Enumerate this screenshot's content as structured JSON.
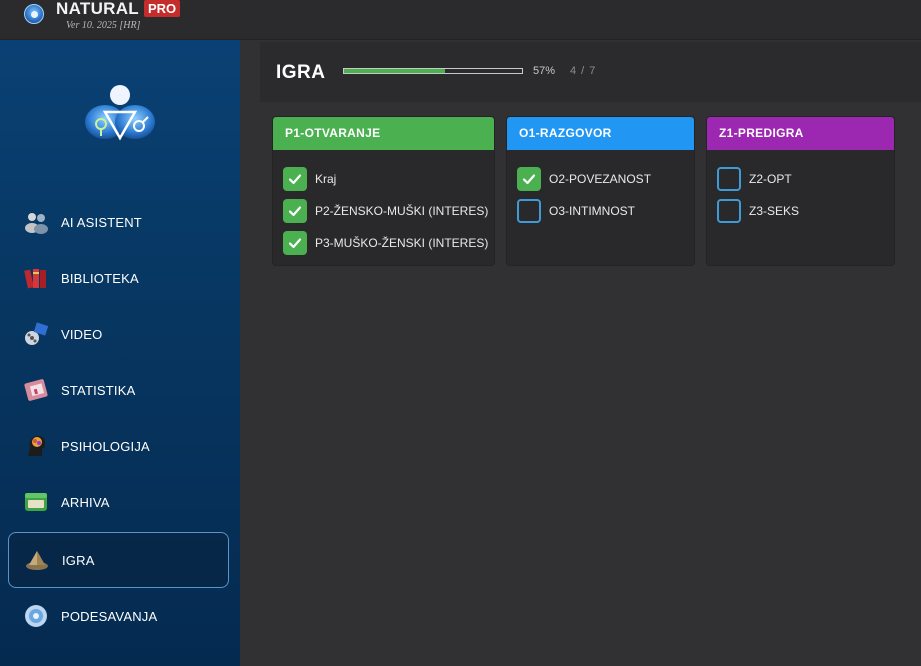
{
  "app": {
    "name": "NATURAL",
    "badge": "PRO",
    "version": "Ver 10. 2025 [HR]"
  },
  "sidebar": {
    "items": [
      {
        "label": "AI ASISTENT",
        "icon": "people-icon",
        "active": false
      },
      {
        "label": "BIBLIOTEKA",
        "icon": "books-icon",
        "active": false
      },
      {
        "label": "VIDEO",
        "icon": "film-reel-icon",
        "active": false
      },
      {
        "label": "STATISTIKA",
        "icon": "chart-icon",
        "active": false
      },
      {
        "label": "PSIHOLOGIJA",
        "icon": "head-brain-icon",
        "active": false
      },
      {
        "label": "ARHIVA",
        "icon": "archive-icon",
        "active": false
      },
      {
        "label": "IGRA",
        "icon": "pyramid-icon",
        "active": true
      },
      {
        "label": "PODESAVANJA",
        "icon": "settings-disc-icon",
        "active": false
      }
    ]
  },
  "header": {
    "title": "IGRA",
    "progress_percent": 57,
    "progress_label": "57%",
    "count_label": "4 / 7"
  },
  "columns": [
    {
      "title": "P1-OTVARANJE",
      "color": "#4bb04f",
      "items": [
        {
          "label": "Kraj",
          "checked": true
        },
        {
          "label": "P2-ŽENSKO-MUŠKI (INTERES)",
          "checked": true
        },
        {
          "label": "P3-MUŠKO-ŽENSKI (INTERES)",
          "checked": true
        }
      ]
    },
    {
      "title": "O1-RAZGOVOR",
      "color": "#2196f3",
      "items": [
        {
          "label": "O2-POVEZANOST",
          "checked": true
        },
        {
          "label": "O3-INTIMNOST",
          "checked": false
        }
      ]
    },
    {
      "title": "Z1-PREDIGRA",
      "color": "#9c27b0",
      "items": [
        {
          "label": "Z2-OPT",
          "checked": false
        },
        {
          "label": "Z3-SEKS",
          "checked": false
        }
      ]
    }
  ]
}
